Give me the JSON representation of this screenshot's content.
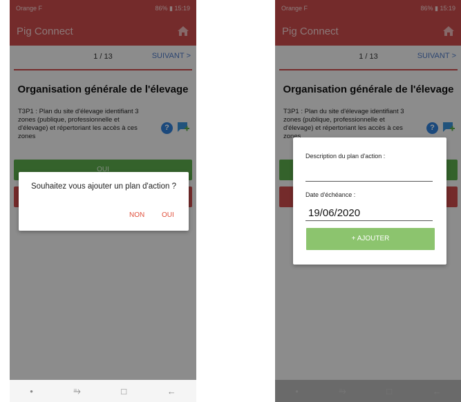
{
  "status_bar": {
    "carrier": "Orange F",
    "right": "86% ▮ 15:19"
  },
  "app": {
    "title": "Pig Connect"
  },
  "pager": {
    "text": "1 / 13",
    "next_label": "SUIVANT"
  },
  "section": {
    "title": "Organisation générale de l'élevage",
    "question": "T3P1 : Plan du site d'élevage identifiant 3 zones (publique, professionnelle et d'élevage) et répertoriant les accès à ces zones"
  },
  "answer_buttons": {
    "oui_label": "OUI"
  },
  "confirm_dialog": {
    "message": "Souhaitez vous ajouter un plan d'action ?",
    "non_label": "NON",
    "oui_label": "OUI"
  },
  "action_plan_dialog": {
    "description_label": "Description du plan d'action :",
    "description_value": "",
    "date_label": "Date d'échéance :",
    "date_value": "19/06/2020",
    "add_label": "+ AJOUTER"
  },
  "nav_bar": {
    "recent": "⥱",
    "home": "□",
    "back": "←"
  },
  "colors": {
    "brand_red": "#c94a4a",
    "link_blue": "#4a76c2",
    "green": "#5aaa4b",
    "dialog_accent": "#e0503c"
  }
}
